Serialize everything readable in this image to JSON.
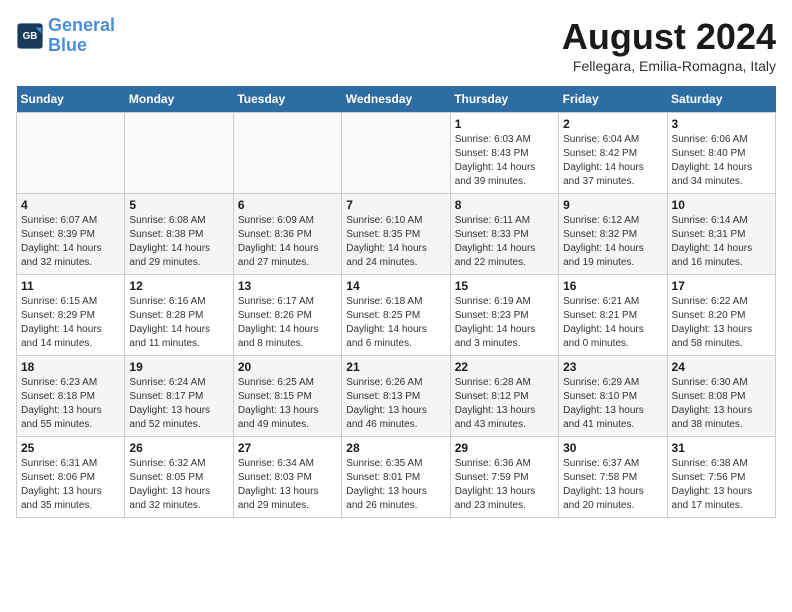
{
  "header": {
    "logo_line1": "General",
    "logo_line2": "Blue",
    "month_title": "August 2024",
    "location": "Fellegara, Emilia-Romagna, Italy"
  },
  "days_of_week": [
    "Sunday",
    "Monday",
    "Tuesday",
    "Wednesday",
    "Thursday",
    "Friday",
    "Saturday"
  ],
  "weeks": [
    [
      {
        "day": "",
        "info": ""
      },
      {
        "day": "",
        "info": ""
      },
      {
        "day": "",
        "info": ""
      },
      {
        "day": "",
        "info": ""
      },
      {
        "day": "1",
        "info": "Sunrise: 6:03 AM\nSunset: 8:43 PM\nDaylight: 14 hours and 39 minutes."
      },
      {
        "day": "2",
        "info": "Sunrise: 6:04 AM\nSunset: 8:42 PM\nDaylight: 14 hours and 37 minutes."
      },
      {
        "day": "3",
        "info": "Sunrise: 6:06 AM\nSunset: 8:40 PM\nDaylight: 14 hours and 34 minutes."
      }
    ],
    [
      {
        "day": "4",
        "info": "Sunrise: 6:07 AM\nSunset: 8:39 PM\nDaylight: 14 hours and 32 minutes."
      },
      {
        "day": "5",
        "info": "Sunrise: 6:08 AM\nSunset: 8:38 PM\nDaylight: 14 hours and 29 minutes."
      },
      {
        "day": "6",
        "info": "Sunrise: 6:09 AM\nSunset: 8:36 PM\nDaylight: 14 hours and 27 minutes."
      },
      {
        "day": "7",
        "info": "Sunrise: 6:10 AM\nSunset: 8:35 PM\nDaylight: 14 hours and 24 minutes."
      },
      {
        "day": "8",
        "info": "Sunrise: 6:11 AM\nSunset: 8:33 PM\nDaylight: 14 hours and 22 minutes."
      },
      {
        "day": "9",
        "info": "Sunrise: 6:12 AM\nSunset: 8:32 PM\nDaylight: 14 hours and 19 minutes."
      },
      {
        "day": "10",
        "info": "Sunrise: 6:14 AM\nSunset: 8:31 PM\nDaylight: 14 hours and 16 minutes."
      }
    ],
    [
      {
        "day": "11",
        "info": "Sunrise: 6:15 AM\nSunset: 8:29 PM\nDaylight: 14 hours and 14 minutes."
      },
      {
        "day": "12",
        "info": "Sunrise: 6:16 AM\nSunset: 8:28 PM\nDaylight: 14 hours and 11 minutes."
      },
      {
        "day": "13",
        "info": "Sunrise: 6:17 AM\nSunset: 8:26 PM\nDaylight: 14 hours and 8 minutes."
      },
      {
        "day": "14",
        "info": "Sunrise: 6:18 AM\nSunset: 8:25 PM\nDaylight: 14 hours and 6 minutes."
      },
      {
        "day": "15",
        "info": "Sunrise: 6:19 AM\nSunset: 8:23 PM\nDaylight: 14 hours and 3 minutes."
      },
      {
        "day": "16",
        "info": "Sunrise: 6:21 AM\nSunset: 8:21 PM\nDaylight: 14 hours and 0 minutes."
      },
      {
        "day": "17",
        "info": "Sunrise: 6:22 AM\nSunset: 8:20 PM\nDaylight: 13 hours and 58 minutes."
      }
    ],
    [
      {
        "day": "18",
        "info": "Sunrise: 6:23 AM\nSunset: 8:18 PM\nDaylight: 13 hours and 55 minutes."
      },
      {
        "day": "19",
        "info": "Sunrise: 6:24 AM\nSunset: 8:17 PM\nDaylight: 13 hours and 52 minutes."
      },
      {
        "day": "20",
        "info": "Sunrise: 6:25 AM\nSunset: 8:15 PM\nDaylight: 13 hours and 49 minutes."
      },
      {
        "day": "21",
        "info": "Sunrise: 6:26 AM\nSunset: 8:13 PM\nDaylight: 13 hours and 46 minutes."
      },
      {
        "day": "22",
        "info": "Sunrise: 6:28 AM\nSunset: 8:12 PM\nDaylight: 13 hours and 43 minutes."
      },
      {
        "day": "23",
        "info": "Sunrise: 6:29 AM\nSunset: 8:10 PM\nDaylight: 13 hours and 41 minutes."
      },
      {
        "day": "24",
        "info": "Sunrise: 6:30 AM\nSunset: 8:08 PM\nDaylight: 13 hours and 38 minutes."
      }
    ],
    [
      {
        "day": "25",
        "info": "Sunrise: 6:31 AM\nSunset: 8:06 PM\nDaylight: 13 hours and 35 minutes."
      },
      {
        "day": "26",
        "info": "Sunrise: 6:32 AM\nSunset: 8:05 PM\nDaylight: 13 hours and 32 minutes."
      },
      {
        "day": "27",
        "info": "Sunrise: 6:34 AM\nSunset: 8:03 PM\nDaylight: 13 hours and 29 minutes."
      },
      {
        "day": "28",
        "info": "Sunrise: 6:35 AM\nSunset: 8:01 PM\nDaylight: 13 hours and 26 minutes."
      },
      {
        "day": "29",
        "info": "Sunrise: 6:36 AM\nSunset: 7:59 PM\nDaylight: 13 hours and 23 minutes."
      },
      {
        "day": "30",
        "info": "Sunrise: 6:37 AM\nSunset: 7:58 PM\nDaylight: 13 hours and 20 minutes."
      },
      {
        "day": "31",
        "info": "Sunrise: 6:38 AM\nSunset: 7:56 PM\nDaylight: 13 hours and 17 minutes."
      }
    ]
  ]
}
